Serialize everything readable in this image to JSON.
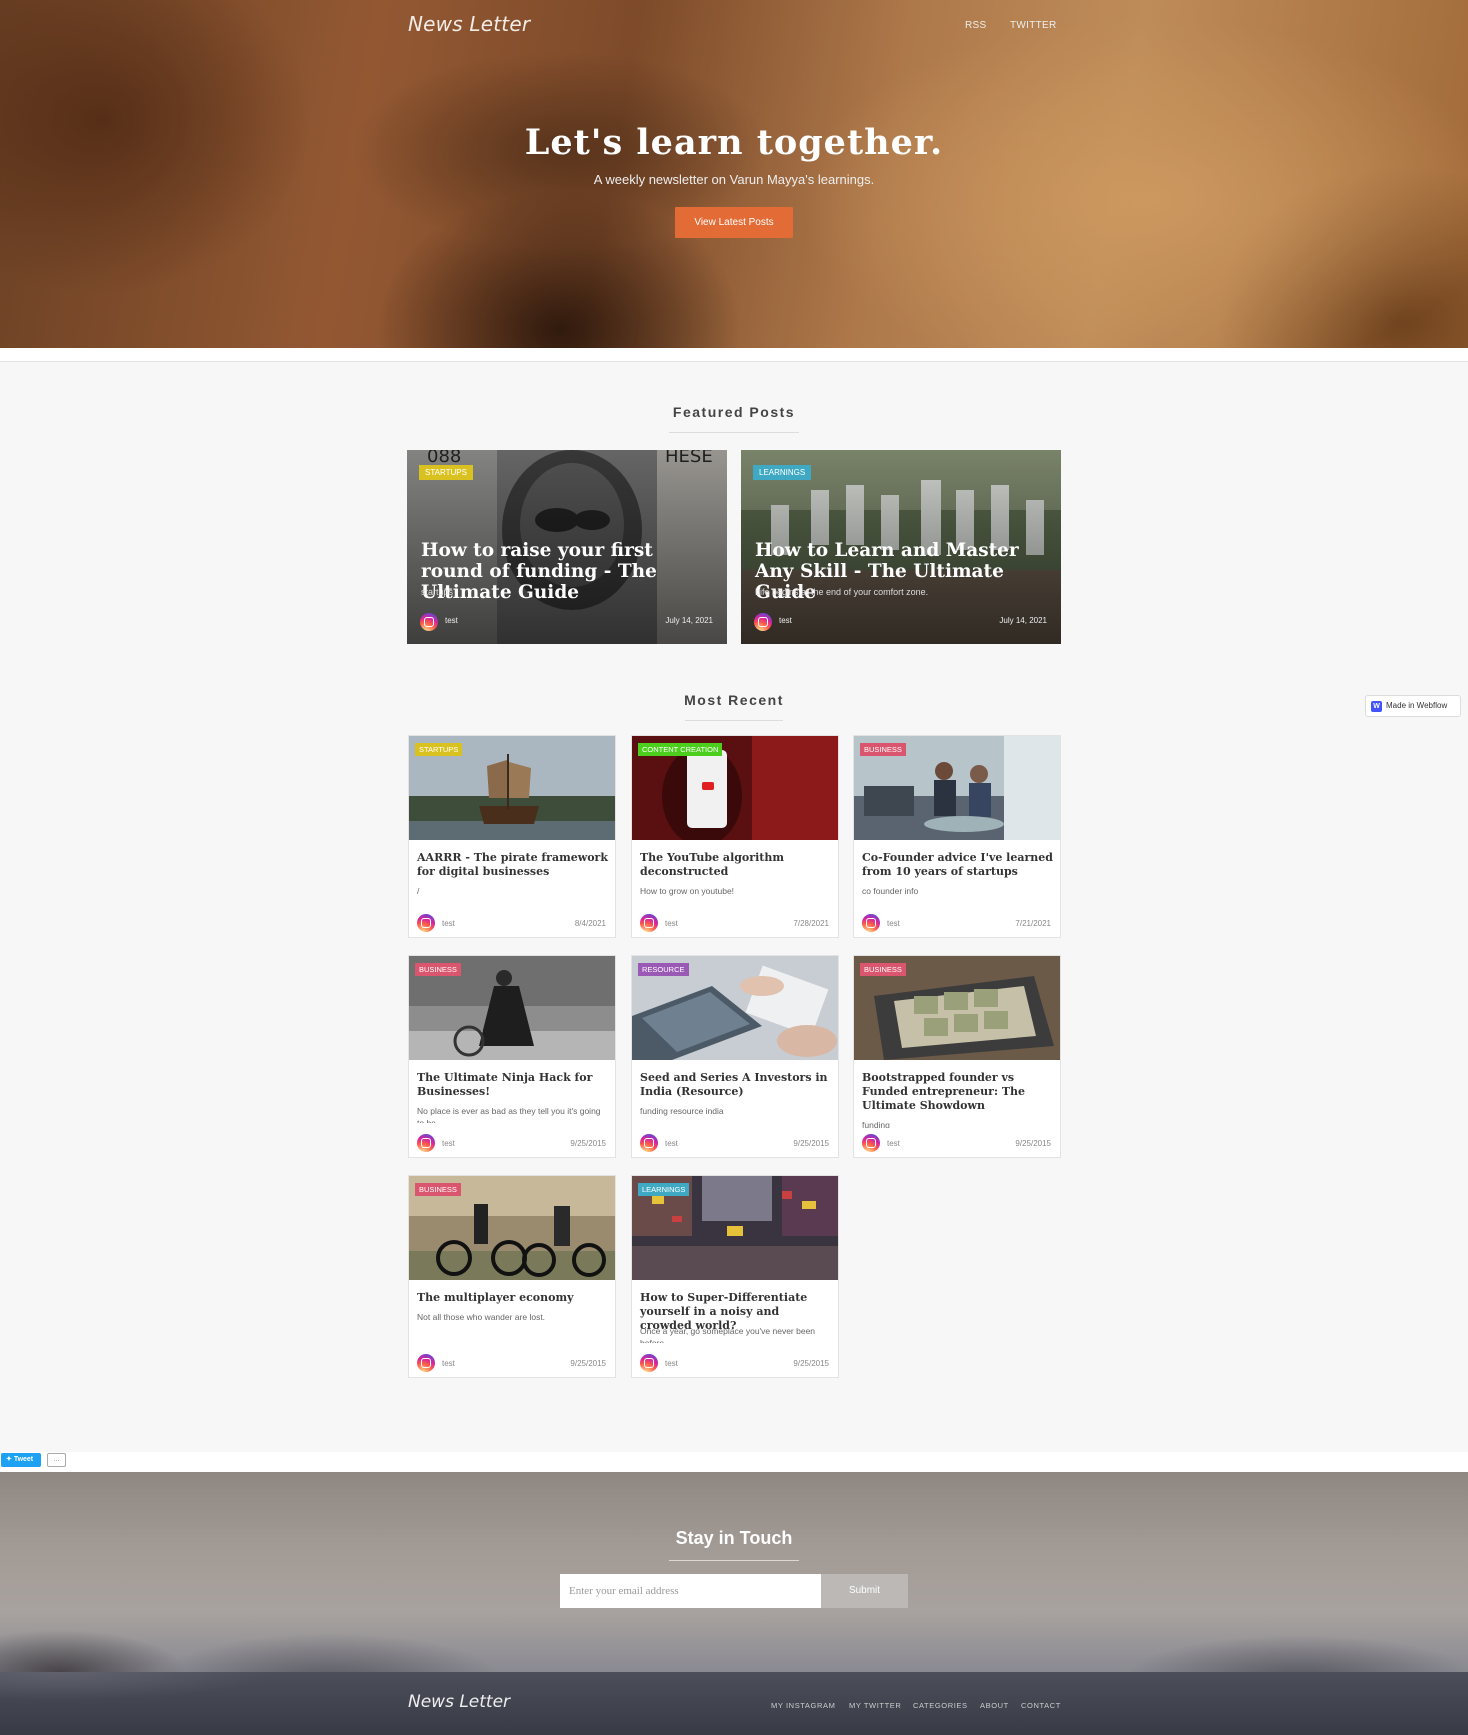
{
  "hero": {
    "brand": "News Letter",
    "nav": [
      "RSS",
      "TWITTER"
    ],
    "title": "Let's learn together.",
    "subtitle": "A weekly newsletter on Varun Mayya's learnings.",
    "cta": "View Latest Posts"
  },
  "featured": {
    "heading": "Featured Posts",
    "posts": [
      {
        "category": "STARTUPS",
        "category_color": "#d9c21f",
        "title": "How to raise your first round of funding - The Ultimate Guide",
        "summary": "startups",
        "author": "test",
        "date": "July 14, 2021"
      },
      {
        "category": "LEARNINGS",
        "category_color": "#3fa9c4",
        "title": "How to Learn and Master Any Skill - The Ultimate Guide",
        "summary": "Life begins at the end of your comfort zone.",
        "author": "test",
        "date": "July 14, 2021"
      }
    ]
  },
  "recent": {
    "heading": "Most Recent",
    "posts": [
      {
        "category": "STARTUPS",
        "category_color": "#d9c21f",
        "title": "AARRR - The pirate framework for digital businesses",
        "summary": "/",
        "author": "test",
        "date": "8/4/2021"
      },
      {
        "category": "CONTENT CREATION",
        "category_color": "#4ccf1c",
        "title": "The YouTube algorithm deconstructed",
        "summary": "How to grow on youtube!",
        "author": "test",
        "date": "7/28/2021"
      },
      {
        "category": "BUSINESS",
        "category_color": "#d9566e",
        "title": "Co-Founder advice I've learned from 10 years of startups",
        "summary": "co founder info",
        "author": "test",
        "date": "7/21/2021"
      },
      {
        "category": "BUSINESS",
        "category_color": "#d9566e",
        "title": "The Ultimate Ninja Hack for Businesses!",
        "summary": "No place is ever as bad as they tell you it's going to be",
        "author": "test",
        "date": "9/25/2015"
      },
      {
        "category": "RESOURCE",
        "category_color": "#9b59b6",
        "title": "Seed and Series A Investors in India (Resource)",
        "summary": "funding resource india",
        "author": "test",
        "date": "9/25/2015"
      },
      {
        "category": "BUSINESS",
        "category_color": "#d9566e",
        "title": "Bootstrapped founder vs Funded entrepreneur: The Ultimate Showdown",
        "summary": "funding",
        "author": "test",
        "date": "9/25/2015"
      },
      {
        "category": "BUSINESS",
        "category_color": "#d9566e",
        "title": "The multiplayer economy",
        "summary": "Not all those who wander are lost.",
        "author": "test",
        "date": "9/25/2015"
      },
      {
        "category": "LEARNINGS",
        "category_color": "#3fa9c4",
        "title": "How to Super-Differentiate yourself in a noisy and crowded world?",
        "summary": "Once a year, go someplace you've never been before",
        "author": "test",
        "date": "9/25/2015"
      }
    ]
  },
  "webflow_badge": "Made in Webflow",
  "tweet": {
    "label": "Tweet",
    "count": "..."
  },
  "subscribe": {
    "heading": "Stay in Touch",
    "placeholder": "Enter your email address",
    "button": "Submit"
  },
  "footer": {
    "brand": "News Letter",
    "links": [
      "MY INSTAGRAM",
      "MY TWITTER",
      "CATEGORIES",
      "ABOUT",
      "CONTACT"
    ]
  }
}
